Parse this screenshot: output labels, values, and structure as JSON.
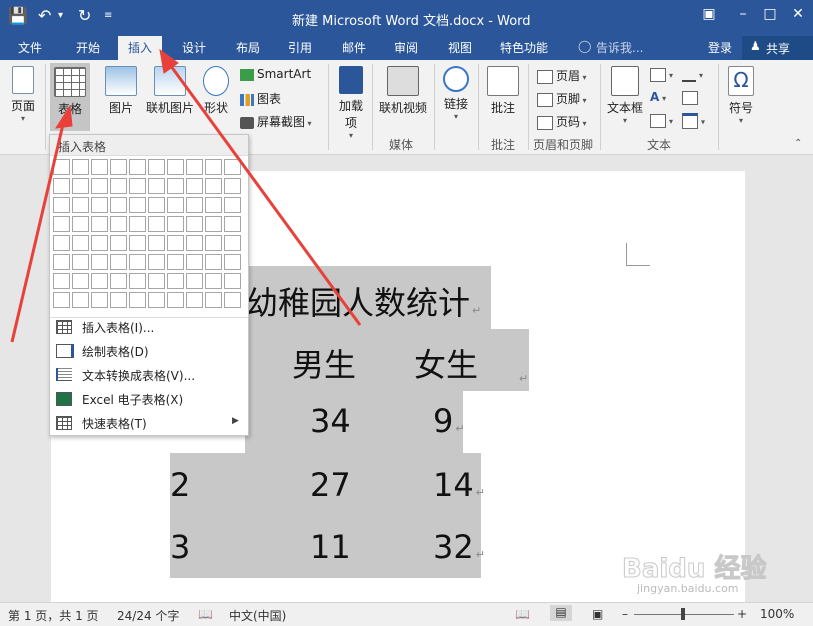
{
  "window": {
    "title": "新建 Microsoft Word 文档.docx - Word"
  },
  "tabs": [
    "文件",
    "开始",
    "插入",
    "设计",
    "布局",
    "引用",
    "邮件",
    "审阅",
    "视图",
    "特色功能"
  ],
  "tell_me": "告诉我...",
  "login": "登录",
  "share": "共享",
  "ribbon": {
    "page": "页面",
    "table": "表格",
    "picture": "图片",
    "online_picture": "联机图片",
    "shapes": "形状",
    "smartart": "SmartArt",
    "chart": "图表",
    "screenshot": "屏幕截图",
    "addins": "加载项",
    "online_video": "联机视频",
    "link": "链接",
    "comment": "批注",
    "header": "页眉",
    "footer": "页脚",
    "page_number": "页码",
    "textbox": "文本框",
    "symbol": "符号",
    "groups": {
      "media": "媒体",
      "comments": "批注",
      "header_footer": "页眉和页脚",
      "text": "文本"
    }
  },
  "dropdown": {
    "title": "插入表格",
    "items": [
      {
        "label": "插入表格(I)...",
        "icon": "insert-table-icon"
      },
      {
        "label": "绘制表格(D)",
        "icon": "draw-table-icon"
      },
      {
        "label": "文本转换成表格(V)...",
        "icon": "text-to-table-icon"
      },
      {
        "label": "Excel 电子表格(X)",
        "icon": "excel-icon"
      },
      {
        "label": "快速表格(T)",
        "icon": "quick-table-icon"
      }
    ]
  },
  "document": {
    "title": "幼稚园人数统计",
    "header_male": "男生",
    "header_female": "女生",
    "rows": [
      {
        "idx": "",
        "male": "34",
        "female": "9"
      },
      {
        "idx": "2",
        "male": "27",
        "female": "14"
      },
      {
        "idx": "3",
        "male": "11",
        "female": "32"
      }
    ]
  },
  "status": {
    "page": "第 1 页，共 1 页",
    "words": "24/24 个字",
    "lang": "中文(中国)",
    "zoom": "100%"
  },
  "watermark": "Baidu 经验",
  "watermark_url": "jingyan.baidu.com",
  "colors": {
    "accent": "#2b579a",
    "arrow": "#e8413a",
    "selection": "#c8c8c8"
  }
}
